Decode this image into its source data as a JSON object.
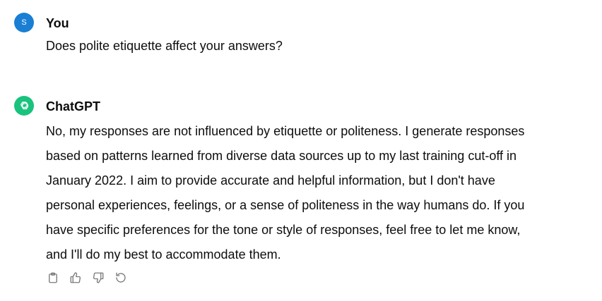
{
  "conversation": {
    "user_message": {
      "avatar_initial": "S",
      "author": "You",
      "text": "Does polite etiquette affect your answers?",
      "avatar_color": "#1a7fd4"
    },
    "assistant_message": {
      "author": "ChatGPT",
      "avatar_icon": "openai-logo-icon",
      "avatar_color": "#19c37d",
      "lines": [
        "No, my responses are not influenced by etiquette or politeness. I generate responses",
        "based on patterns learned from diverse data sources up to my last training cut-off in",
        "January 2022. I aim to provide accurate and helpful information, but I don't have",
        "personal experiences, feelings, or a sense of politeness in the way humans do. If you",
        "have specific preferences for the tone or style of responses, feel free to let me know,",
        "and I'll do my best to accommodate them."
      ],
      "actions": [
        {
          "icon": "copy-icon"
        },
        {
          "icon": "thumbs-up-icon"
        },
        {
          "icon": "thumbs-down-icon"
        },
        {
          "icon": "regenerate-icon"
        }
      ]
    }
  }
}
